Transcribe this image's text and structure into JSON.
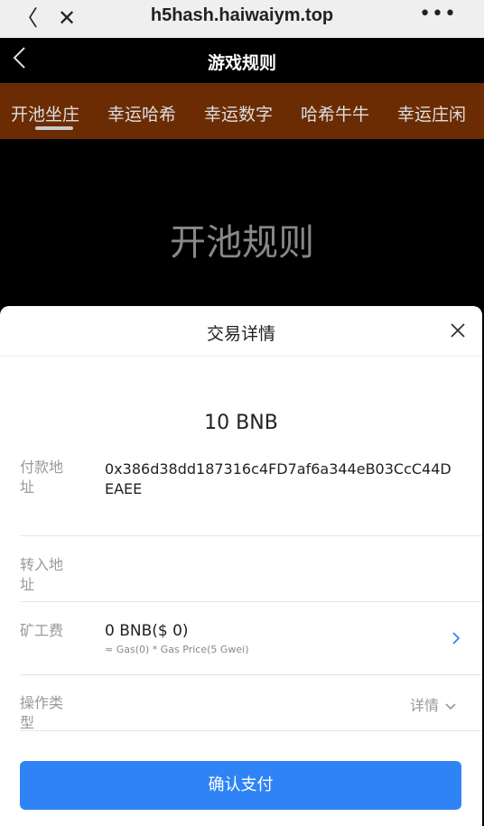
{
  "browser": {
    "url": "h5hash.haiwaiym.top",
    "back_glyph": "〈",
    "close_glyph": "✕",
    "more_glyph": "•••"
  },
  "header": {
    "title": "游戏规则"
  },
  "tabs": [
    {
      "label": "开池坐庄",
      "active": true
    },
    {
      "label": "幸运哈希",
      "active": false
    },
    {
      "label": "幸运数字",
      "active": false
    },
    {
      "label": "哈希牛牛",
      "active": false
    },
    {
      "label": "幸运庄闲",
      "active": false
    }
  ],
  "hero": {
    "title": "开池规则"
  },
  "sheet": {
    "title": "交易详情",
    "amount": "10 BNB",
    "payer": {
      "label": "付款地址",
      "value": "0x386d38dd187316c4FD7af6a344eB03CcC44DEAEE"
    },
    "receiver": {
      "label": "转入地址",
      "value": ""
    },
    "fee": {
      "label": "矿工费",
      "value": "0 BNB($ 0)",
      "sub": "≈ Gas(0) * Gas Price(5 Gwei)"
    },
    "operation": {
      "label": "操作类型",
      "toggle": "详情"
    },
    "confirm_label": "确认支付"
  },
  "colors": {
    "tab_bar": "#6b2c04",
    "confirm": "#2f83f5",
    "link_chevron": "#2f83f5"
  }
}
